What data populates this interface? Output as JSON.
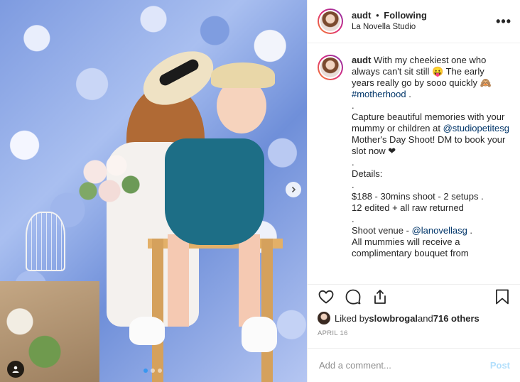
{
  "header": {
    "username": "audt",
    "separator": "•",
    "follow_status": "Following",
    "location": "La Novella Studio",
    "more_icon": "more-horizontal-icon",
    "more_label": "•••"
  },
  "caption": {
    "username": "audt",
    "lines": [
      "With my cheekiest one who always can't sit still 😛 The early years really go by sooo quickly 🙈"
    ],
    "hashtag": "#motherhood",
    "after_hashtag": " .",
    "dot1": ".",
    "para2_a": "Capture beautiful memories with your mummy or children at ",
    "mention1": "@studiopetitesg",
    "para2_b": " Mother's Day Shoot! DM to book your slot now ❤",
    "dot2": ".",
    "details_label": "Details:",
    "dot3": ".",
    "price_line": "$188 - 30mins shoot - 2 setups .",
    "edit_line": "12 edited + all raw returned",
    "dot4": ".",
    "venue_a": "Shoot venue - ",
    "mention2": "@lanovellasg",
    "venue_b": " .",
    "mummies_line": "All mummies will receive a",
    "complimentary_line": "complimentary bouquet from"
  },
  "actions": {
    "like_icon": "heart-icon",
    "comment_icon": "comment-icon",
    "share_icon": "share-icon",
    "save_icon": "bookmark-icon"
  },
  "likes": {
    "prefix": "Liked by ",
    "user": "slowbrogal",
    "middle": " and ",
    "count": "716 others"
  },
  "date": "APRIL 16",
  "comment": {
    "placeholder": "Add a comment...",
    "post_label": "Post"
  },
  "photo": {
    "user_tag_icon": "person-icon",
    "next_icon": "chevron-right-icon",
    "carousel_total": 3,
    "carousel_active": 1
  },
  "colors": {
    "link": "#003569",
    "accent": "#3897f0",
    "post_disabled": "#b2dffc",
    "muted": "#8e8e8e"
  }
}
